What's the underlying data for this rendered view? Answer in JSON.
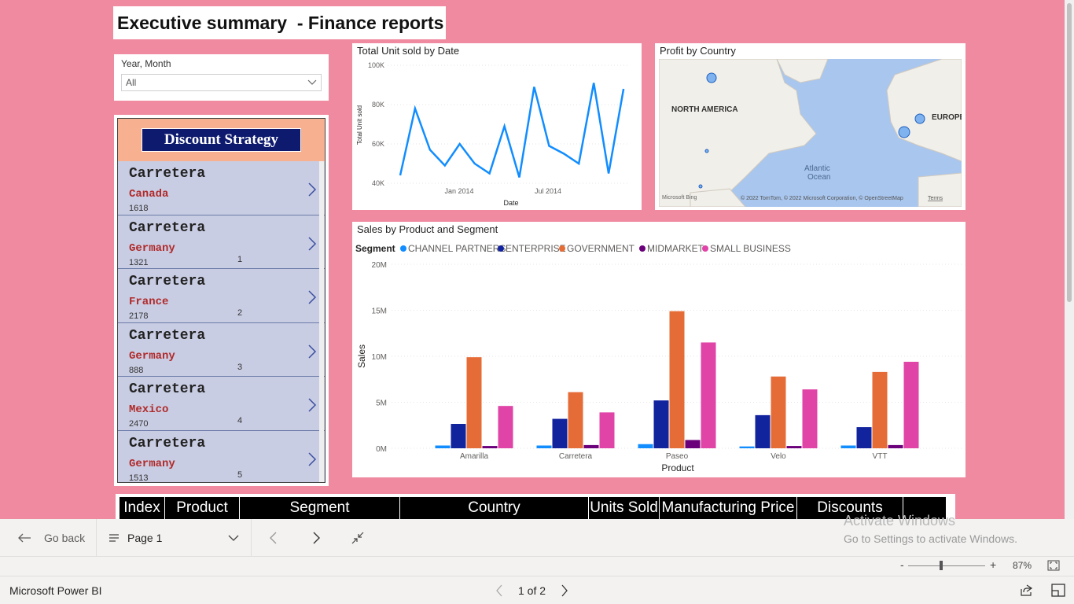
{
  "report": {
    "title": "Executive summary  - Finance reports"
  },
  "slicer": {
    "label": "Year, Month",
    "value": "All"
  },
  "discount_panel": {
    "banner": "Discount Strategy",
    "items": [
      {
        "product": "Carretera",
        "country": "Canada",
        "units": "1618",
        "index": ""
      },
      {
        "product": "Carretera",
        "country": "Germany",
        "units": "1321",
        "index": "1"
      },
      {
        "product": "Carretera",
        "country": "France",
        "units": "2178",
        "index": "2"
      },
      {
        "product": "Carretera",
        "country": "Germany",
        "units": "888",
        "index": "3"
      },
      {
        "product": "Carretera",
        "country": "Mexico",
        "units": "2470",
        "index": "4"
      },
      {
        "product": "Carretera",
        "country": "Germany",
        "units": "1513",
        "index": "5"
      }
    ]
  },
  "line_chart": {
    "title": "Total Unit sold by Date"
  },
  "map_chart": {
    "title": "Profit by Country",
    "labels": [
      "NORTH AMERICA",
      "EUROPE",
      "Atlantic",
      "Ocean"
    ],
    "attribution": "© 2022 TomTom, © 2022 Microsoft Corporation, © OpenStreetMap",
    "terms": "Terms",
    "brand": "Microsoft Bing"
  },
  "bar_chart": {
    "title": "Sales by Product and Segment",
    "legend_title": "Segment"
  },
  "chart_data": [
    {
      "type": "line",
      "title": "Total Unit sold by Date",
      "xlabel": "Date",
      "ylabel": "Total Unit sold",
      "x_ticks": [
        "Jan 2014",
        "Jul 2014"
      ],
      "y_ticks": [
        "40K",
        "60K",
        "80K",
        "100K"
      ],
      "ylim": [
        40000,
        100000
      ],
      "x": [
        "2013-09",
        "2013-10",
        "2013-11",
        "2013-12",
        "2014-01",
        "2014-02",
        "2014-03",
        "2014-04",
        "2014-05",
        "2014-06",
        "2014-07",
        "2014-08",
        "2014-09",
        "2014-10",
        "2014-11",
        "2014-12"
      ],
      "values": [
        44000,
        78000,
        57000,
        49000,
        60000,
        50000,
        45000,
        69000,
        43000,
        89000,
        59000,
        55000,
        50000,
        91000,
        45000,
        88000
      ],
      "color": "#118dff"
    },
    {
      "type": "bar",
      "title": "Sales by Product and Segment",
      "xlabel": "Product",
      "ylabel": "Sales",
      "categories": [
        "Amarilla",
        "Carretera",
        "Paseo",
        "Velo",
        "VTT"
      ],
      "y_ticks": [
        "0M",
        "5M",
        "10M",
        "15M",
        "20M"
      ],
      "ylim": [
        0,
        20000000
      ],
      "legend_position": "top-left",
      "series": [
        {
          "name": "CHANNEL PARTNERS",
          "color": "#118dff",
          "values": [
            300000,
            300000,
            450000,
            200000,
            300000
          ]
        },
        {
          "name": "ENTERPRISE",
          "color": "#12239e",
          "values": [
            2650000,
            3200000,
            5200000,
            3600000,
            2300000
          ]
        },
        {
          "name": "GOVERNMENT",
          "color": "#e66c37",
          "values": [
            9900000,
            6100000,
            14900000,
            7800000,
            8300000
          ]
        },
        {
          "name": "MIDMARKET",
          "color": "#6b007b",
          "values": [
            250000,
            350000,
            900000,
            250000,
            350000
          ]
        },
        {
          "name": "SMALL BUSINESS",
          "color": "#e044a7",
          "values": [
            4600000,
            3900000,
            11500000,
            6400000,
            9400000
          ]
        }
      ]
    }
  ],
  "table": {
    "columns": [
      "Index",
      "Product",
      "Segment",
      "Country",
      "Units Sold",
      "Manufacturing Price",
      "Discounts",
      ""
    ]
  },
  "nav": {
    "go_back": "Go back",
    "page_label": "Page 1"
  },
  "watermark": {
    "line1": "Activate Windows",
    "line2": "Go to Settings to activate Windows."
  },
  "zoom": {
    "level": "87%",
    "minus": "-",
    "plus": "+"
  },
  "status": {
    "app_name": "Microsoft Power BI",
    "page_counter": "1 of 2"
  }
}
